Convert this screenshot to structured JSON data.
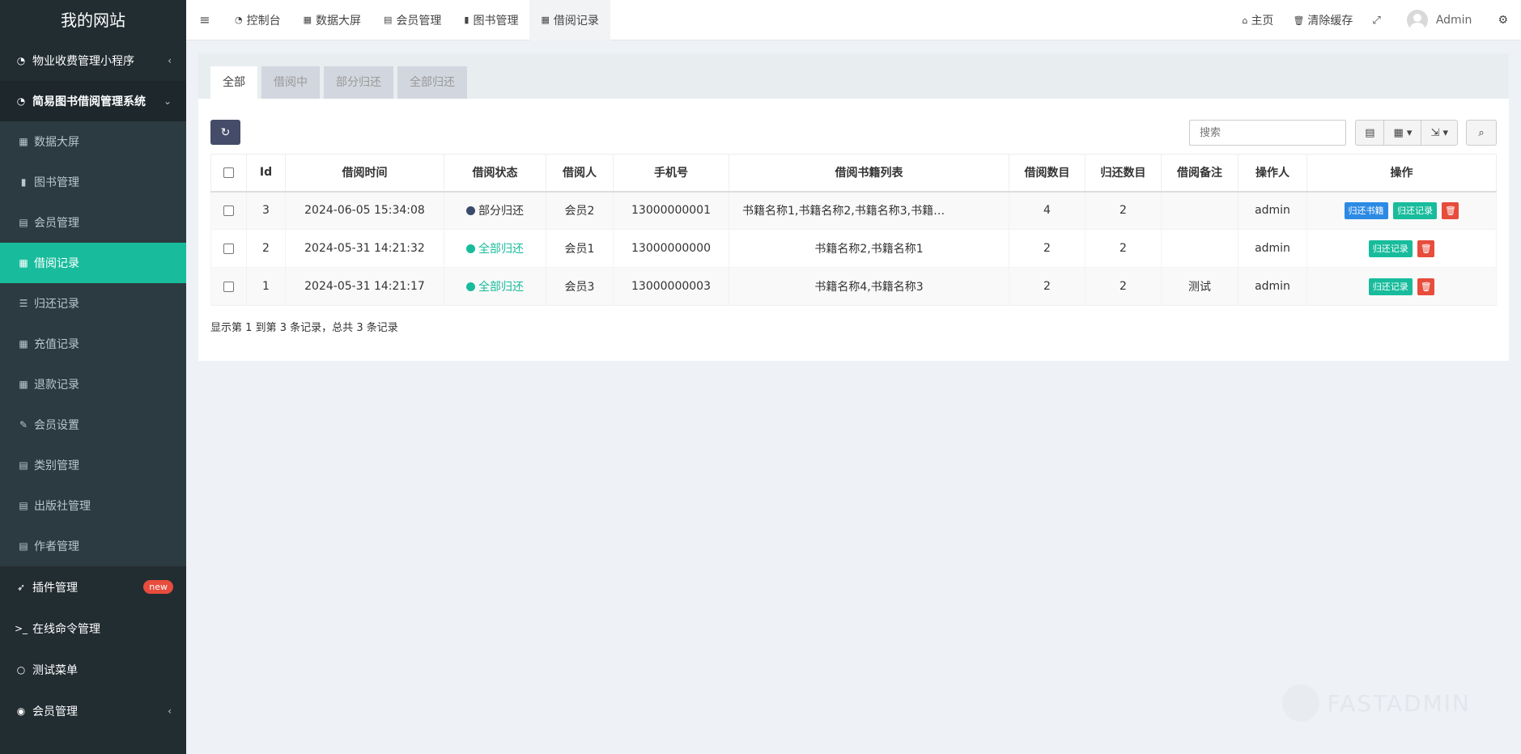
{
  "sidebar": {
    "logo": "我的网站",
    "top_item_1": "物业收费管理小程序",
    "top_item_2": "简易图书借阅管理系统",
    "sub_items": [
      "数据大屏",
      "图书管理",
      "会员管理",
      "借阅记录",
      "归还记录",
      "充值记录",
      "退款记录",
      "会员设置",
      "类别管理",
      "出版社管理",
      "作者管理"
    ],
    "plugin_label": "插件管理",
    "plugin_badge": "new",
    "cmd_label": "在线命令管理",
    "test_label": "测试菜单",
    "member_label": "会员管理"
  },
  "header": {
    "tabs": [
      "控制台",
      "数据大屏",
      "会员管理",
      "图书管理",
      "借阅记录"
    ],
    "home": "主页",
    "clear_cache": "清除缓存",
    "user": "Admin"
  },
  "panel": {
    "tabs": [
      "全部",
      "借阅中",
      "部分归还",
      "全部归还"
    ],
    "search_placeholder": "搜索"
  },
  "table": {
    "columns": [
      "Id",
      "借阅时间",
      "借阅状态",
      "借阅人",
      "手机号",
      "借阅书籍列表",
      "借阅数目",
      "归还数目",
      "借阅备注",
      "操作人",
      "操作"
    ],
    "rows": [
      {
        "id": "3",
        "time": "2024-06-05 15:34:08",
        "status": "部分归还",
        "member": "会员2",
        "phone": "13000000001",
        "books": "书籍名称1,书籍名称2,书籍名称3,书籍…",
        "borrow_count": "4",
        "return_count": "2",
        "remark": "",
        "operator": "admin"
      },
      {
        "id": "2",
        "time": "2024-05-31 14:21:32",
        "status": "全部归还",
        "member": "会员1",
        "phone": "13000000000",
        "books": "书籍名称2,书籍名称1",
        "borrow_count": "2",
        "return_count": "2",
        "remark": "",
        "operator": "admin"
      },
      {
        "id": "1",
        "time": "2024-05-31 14:21:17",
        "status": "全部归还",
        "member": "会员3",
        "phone": "13000000003",
        "books": "书籍名称4,书籍名称3",
        "borrow_count": "2",
        "return_count": "2",
        "remark": "测试",
        "operator": "admin"
      }
    ],
    "btn_return_book": "归还书籍",
    "btn_return_record": "归还记录"
  },
  "pager": {
    "text_1": "显示第",
    "from": "1",
    "text_2": "到第",
    "to": "3",
    "text_3": "条记录，总共",
    "total": "3",
    "text_4": "条记录"
  },
  "watermark": "FASTADMIN",
  "colors": {
    "accent": "#18bc9c",
    "sidebar": "#222d32",
    "partial_dot": "#3b4a6b",
    "blue": "#2c8ae5",
    "red": "#e74c3c"
  }
}
